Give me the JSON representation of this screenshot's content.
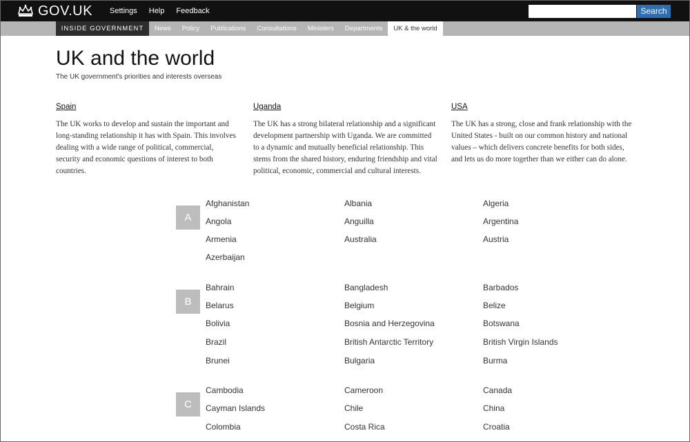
{
  "header": {
    "logo_text": "GOV.UK",
    "nav": [
      "Settings",
      "Help",
      "Feedback"
    ],
    "search_value": "",
    "search_button": "Search"
  },
  "subnav": {
    "section": "INSIDE GOVERNMENT",
    "items": [
      "News",
      "Policy",
      "Publications",
      "Consultations",
      "Ministers",
      "Departments",
      "UK & the world"
    ],
    "active": "UK & the world"
  },
  "page": {
    "title": "UK and the world",
    "subtitle": "The UK government's priorities and interests overseas"
  },
  "featured": [
    {
      "name": "Spain",
      "description": "The UK works to develop and sustain the important and long-standing relationship it has with Spain. This involves dealing with a wide range of political, commercial, security and economic questions of interest to both countries."
    },
    {
      "name": "Uganda",
      "description": "The UK has a strong bilateral relationship and a significant development partnership with Uganda. We are committed to a dynamic and mutually beneficial relationship. This stems from the shared history, enduring friendship and vital political, economic, commercial and cultural interests."
    },
    {
      "name": "USA",
      "description": "The UK has a strong, close and frank relationship with the United States - built on our common history and national values – which delivers concrete benefits for both sides, and lets us do more together than we either can do alone."
    }
  ],
  "groups": [
    {
      "letter": "A",
      "countries": [
        "Afghanistan",
        "Albania",
        "Algeria",
        "Angola",
        "Anguilla",
        "Argentina",
        "Armenia",
        "Australia",
        "Austria",
        "Azerbaijan"
      ]
    },
    {
      "letter": "B",
      "countries": [
        "Bahrain",
        "Bangladesh",
        "Barbados",
        "Belarus",
        "Belgium",
        "Belize",
        "Bolivia",
        "Bosnia and Herzegovina",
        "Botswana",
        "Brazil",
        "British Antarctic Territory",
        "British Virgin Islands",
        "Brunei",
        "Bulgaria",
        "Burma"
      ]
    },
    {
      "letter": "C",
      "countries": [
        "Cambodia",
        "Cameroon",
        "Canada",
        "Cayman Islands",
        "Chile",
        "China",
        "Colombia",
        "Costa Rica",
        "Croatia"
      ]
    }
  ],
  "colors": {
    "header_bg": "#111111",
    "subnav_bg": "#b5b5b5",
    "search_button": "#2b6fb6",
    "letter_box": "#bdbdbd"
  }
}
